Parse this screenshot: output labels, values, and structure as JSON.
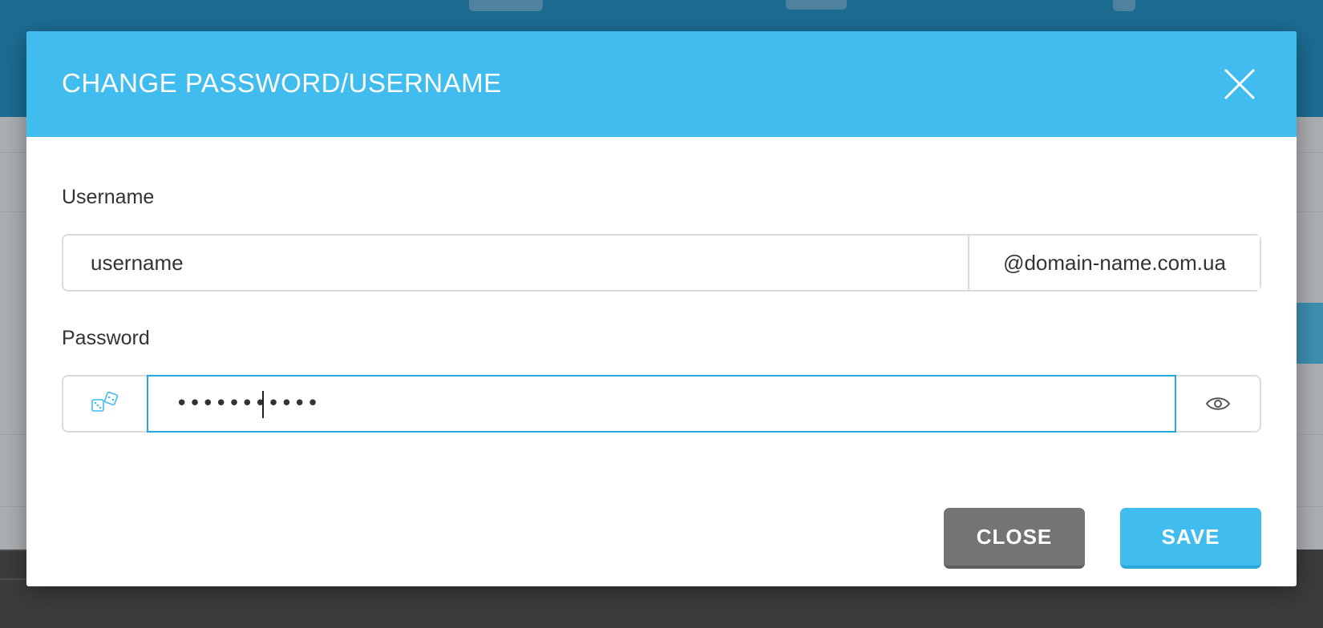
{
  "modal": {
    "title": "CHANGE PASSWORD/USERNAME",
    "close_icon": "close-x-icon"
  },
  "username": {
    "label": "Username",
    "value": "username",
    "domain_suffix": "@domain-name.com.ua"
  },
  "password": {
    "label": "Password",
    "masked_value": "•••••••••••",
    "generate_icon": "dice-icon",
    "visibility_icon": "eye-icon"
  },
  "buttons": {
    "close_label": "CLOSE",
    "save_label": "SAVE"
  },
  "colors": {
    "header": "#40bcef",
    "save_button": "#40bcef",
    "close_button": "#747474",
    "focus_border": "#24a9e1",
    "background_header": "#0b86c0",
    "background_footer": "#3a3c3f"
  }
}
